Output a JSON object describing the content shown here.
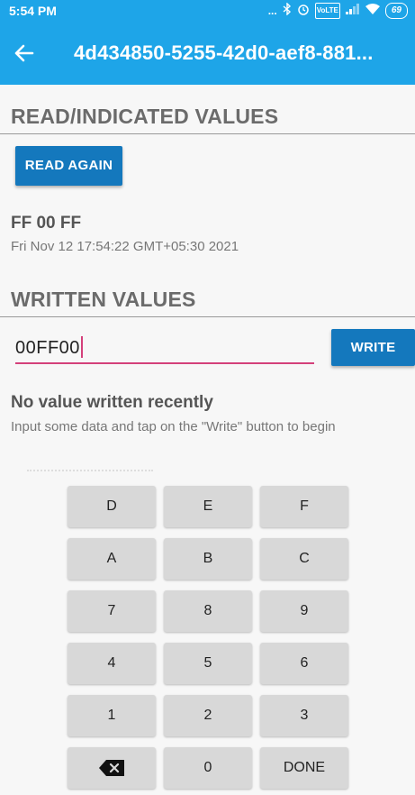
{
  "status_bar": {
    "time": "5:54 PM",
    "dots": "...",
    "volte": "VoLTE",
    "battery": "69"
  },
  "app_bar": {
    "title": "4d434850-5255-42d0-aef8-881..."
  },
  "read_section": {
    "heading": "READ/INDICATED VALUES",
    "button_label": "READ AGAIN",
    "value": "FF 00 FF",
    "timestamp": "Fri Nov 12 17:54:22 GMT+05:30 2021"
  },
  "written_section": {
    "heading": "WRITTEN VALUES",
    "input_value": "00FF00",
    "button_label": "WRITE",
    "empty_title": "No value written recently",
    "empty_hint": "Input some data and tap on the \"Write\" button to begin"
  },
  "keypad": {
    "keys": [
      "D",
      "E",
      "F",
      "A",
      "B",
      "C",
      "7",
      "8",
      "9",
      "4",
      "5",
      "6",
      "1",
      "2",
      "3",
      "",
      "0",
      "DONE"
    ]
  },
  "colors": {
    "app_bar": "#1ea5e8",
    "button": "#1478bd",
    "input_underline": "#d4407a"
  }
}
